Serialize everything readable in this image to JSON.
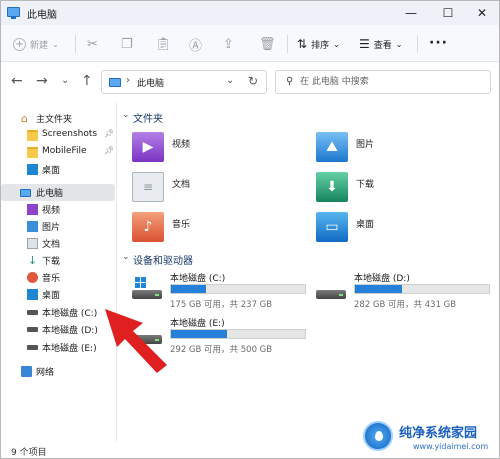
{
  "window": {
    "title": "此电脑",
    "minimize": "—",
    "maximize": "☐",
    "close": "✕"
  },
  "toolbar": {
    "new_label": "新建",
    "sort_label": "排序",
    "view_label": "查看",
    "more_label": "···",
    "icons": [
      "cut-icon",
      "copy-icon",
      "paste-icon",
      "rename-icon",
      "share-icon",
      "delete-icon"
    ]
  },
  "address": {
    "path": "此电脑",
    "search_placeholder": "在 此电脑 中搜索"
  },
  "sidebar": {
    "items": [
      {
        "label": "主文件夹",
        "icon": "home-icon"
      },
      {
        "label": "Screenshots",
        "icon": "folder-icon",
        "pinned": true
      },
      {
        "label": "MobileFile",
        "icon": "folder-icon",
        "pinned": true
      },
      {
        "label": "桌面",
        "icon": "desktop-icon"
      },
      {
        "label": "此电脑",
        "icon": "computer-icon",
        "selected": true
      },
      {
        "label": "视频",
        "icon": "video-icon"
      },
      {
        "label": "图片",
        "icon": "pictures-icon"
      },
      {
        "label": "文档",
        "icon": "documents-icon"
      },
      {
        "label": "下载",
        "icon": "downloads-icon"
      },
      {
        "label": "音乐",
        "icon": "music-icon"
      },
      {
        "label": "桌面",
        "icon": "desktop-icon"
      },
      {
        "label": "本地磁盘 (C:)",
        "icon": "drive-icon"
      },
      {
        "label": "本地磁盘 (D:)",
        "icon": "drive-icon"
      },
      {
        "label": "本地磁盘 (E:)",
        "icon": "drive-icon"
      },
      {
        "label": "网络",
        "icon": "network-icon"
      }
    ]
  },
  "content": {
    "folders_heading": "文件夹",
    "folders": [
      {
        "label": "视频",
        "icon": "video-folder-icon"
      },
      {
        "label": "图片",
        "icon": "pictures-folder-icon"
      },
      {
        "label": "文档",
        "icon": "documents-folder-icon"
      },
      {
        "label": "下载",
        "icon": "downloads-folder-icon"
      },
      {
        "label": "音乐",
        "icon": "music-folder-icon"
      },
      {
        "label": "桌面",
        "icon": "desktop-folder-icon"
      }
    ],
    "drives_heading": "设备和驱动器",
    "drives": [
      {
        "name": "本地磁盘 (C:)",
        "free": "175 GB 可用，共 237 GB",
        "used_fraction": 0.26
      },
      {
        "name": "本地磁盘 (D:)",
        "free": "282 GB 可用，共 431 GB",
        "used_fraction": 0.35
      },
      {
        "name": "本地磁盘 (E:)",
        "free": "292 GB 可用，共 500 GB",
        "used_fraction": 0.42
      }
    ]
  },
  "status": {
    "item_count": "9 个项目"
  },
  "watermark": {
    "title": "纯净系统家园",
    "url": "www.yidaimei.com"
  },
  "colors": {
    "accent": "#2680d9",
    "annotation_arrow": "#e02020"
  }
}
